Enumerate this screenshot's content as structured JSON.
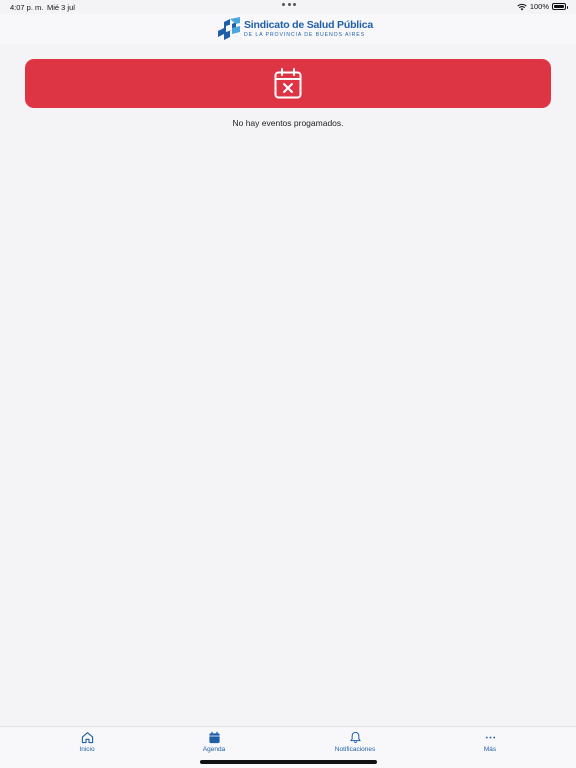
{
  "status_bar": {
    "time": "4:07 p. m.",
    "date": "Mié 3 jul",
    "battery_text": "100%",
    "battery_level": 1.0
  },
  "header": {
    "logo_title": "Sindicato de Salud Pública",
    "logo_subtitle": "DE LA PROVINCIA DE BUENOS AIRES"
  },
  "banner": {
    "color": "#de3545",
    "icon": "calendar-x-icon"
  },
  "empty_state": {
    "message": "No hay eventos progamados."
  },
  "tab_bar": {
    "accent_color": "#1f5fa8",
    "tabs": [
      {
        "label": "Inicio",
        "icon": "home-icon",
        "selected": false
      },
      {
        "label": "Agenda",
        "icon": "calendar-icon",
        "selected": true
      },
      {
        "label": "Notificaciones",
        "icon": "bell-icon",
        "selected": false
      },
      {
        "label": "Más",
        "icon": "more-icon",
        "selected": false
      }
    ]
  }
}
